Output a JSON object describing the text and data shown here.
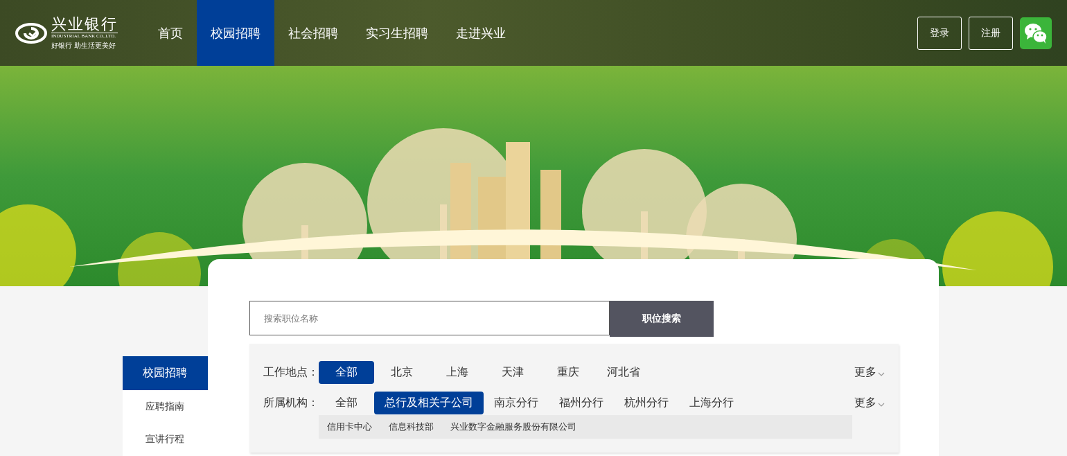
{
  "header": {
    "logo": {
      "name": "兴业银行",
      "english": "INDUSTRIAL BANK CO.,LTD.",
      "slogan": "好银行 助生活更美好"
    },
    "nav": [
      {
        "label": "首页",
        "selected": false
      },
      {
        "label": "校园招聘",
        "selected": true
      },
      {
        "label": "社会招聘",
        "selected": false
      },
      {
        "label": "实习生招聘",
        "selected": false
      },
      {
        "label": "走进兴业",
        "selected": false
      }
    ],
    "buttons": [
      "登录",
      "注册"
    ]
  },
  "sidebar": {
    "items": [
      {
        "label": "校园招聘",
        "selected": true
      },
      {
        "label": "应聘指南",
        "selected": false
      },
      {
        "label": "宣讲行程",
        "selected": false
      }
    ]
  },
  "search": {
    "placeholder": "搜索职位名称",
    "button": "职位搜索"
  },
  "filters": [
    {
      "label": "工作地点：",
      "more": "更多",
      "options": [
        {
          "label": "全部",
          "selected": true
        },
        {
          "label": "北京",
          "selected": false
        },
        {
          "label": "上海",
          "selected": false
        },
        {
          "label": "天津",
          "selected": false
        },
        {
          "label": "重庆",
          "selected": false
        },
        {
          "label": "河北省",
          "selected": false
        }
      ]
    },
    {
      "label": "所属机构：",
      "more": "更多",
      "options": [
        {
          "label": "全部",
          "selected": false
        },
        {
          "label": "总行及相关子公司",
          "selected": true
        },
        {
          "label": "南京分行",
          "selected": false
        },
        {
          "label": "福州分行",
          "selected": false
        },
        {
          "label": "杭州分行",
          "selected": false
        },
        {
          "label": "上海分行",
          "selected": false
        }
      ],
      "sub_options": [
        "信用卡中心",
        "信息科技部",
        "兴业数字金融服务股份有限公司"
      ]
    }
  ]
}
